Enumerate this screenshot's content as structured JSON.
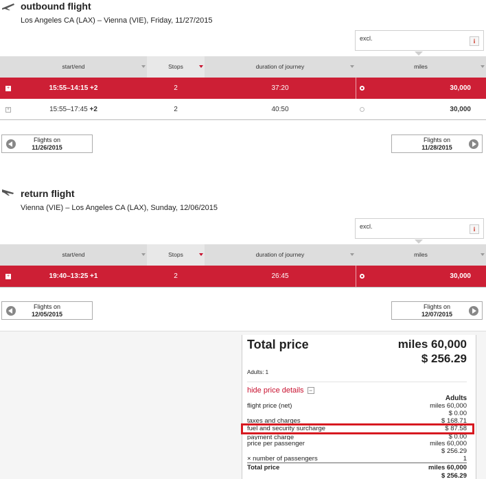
{
  "outbound": {
    "title": "outbound flight",
    "route": "Los Angeles CA (LAX) – Vienna (VIE),  Friday, 11/27/2015",
    "excl_label": "excl.",
    "info_icon": "i",
    "headers": {
      "startend": "start/end",
      "stops": "Stops",
      "duration": "duration of journey",
      "miles": "miles"
    },
    "rows": [
      {
        "plus": "+",
        "time": "15:55–14:15",
        "plus_days": "+2",
        "stops": "2",
        "duration": "37:20",
        "miles": "30,000"
      },
      {
        "plus": "+",
        "time": "15:55–17:45",
        "plus_days": "+2",
        "stops": "2",
        "duration": "40:50",
        "miles": "30,000"
      }
    ],
    "prev": {
      "label": "Flights on",
      "date": "11/26/2015"
    },
    "next": {
      "label": "Flights on",
      "date": "11/28/2015"
    }
  },
  "return": {
    "title": "return flight",
    "route": "Vienna (VIE) – Los Angeles CA (LAX),  Sunday, 12/06/2015",
    "excl_label": "excl.",
    "info_icon": "i",
    "headers": {
      "startend": "start/end",
      "stops": "Stops",
      "duration": "duration of journey",
      "miles": "miles"
    },
    "rows": [
      {
        "plus": "+",
        "time": "19:40–13:25",
        "plus_days": "+1",
        "stops": "2",
        "duration": "26:45",
        "miles": "30,000"
      }
    ],
    "prev": {
      "label": "Flights on",
      "date": "12/05/2015"
    },
    "next": {
      "label": "Flights on",
      "date": "12/07/2015"
    }
  },
  "summary": {
    "total_label": "Total price",
    "total_miles": "miles 60,000",
    "total_usd": "$ 256.29",
    "adults": "Adults: 1",
    "hide_details": "hide price details",
    "collapse_icon": "−",
    "col_header": "Adults",
    "lines": {
      "flight_price": {
        "label": "flight price (net)",
        "v1": "miles 60,000",
        "v2": "$ 0.00"
      },
      "taxes": {
        "label": "taxes and charges",
        "v1": "$ 168.71"
      },
      "fuel": {
        "label": "fuel and security surcharge",
        "v1": "$ 87.58"
      },
      "payment": {
        "label": "payment charge",
        "v1": "$ 0.00"
      },
      "per_pax": {
        "label": "price per passenger",
        "v1": "miles 60,000",
        "v2": "$ 256.29"
      },
      "num_pax": {
        "label": "× number of passengers",
        "v1": "1"
      },
      "total": {
        "label": "Total price",
        "v1": "miles 60,000",
        "v2": "$ 256.29"
      }
    }
  },
  "colors": {
    "accent": "#cd1f35",
    "highlight": "#d71920",
    "header_bg": "#dddddd"
  }
}
